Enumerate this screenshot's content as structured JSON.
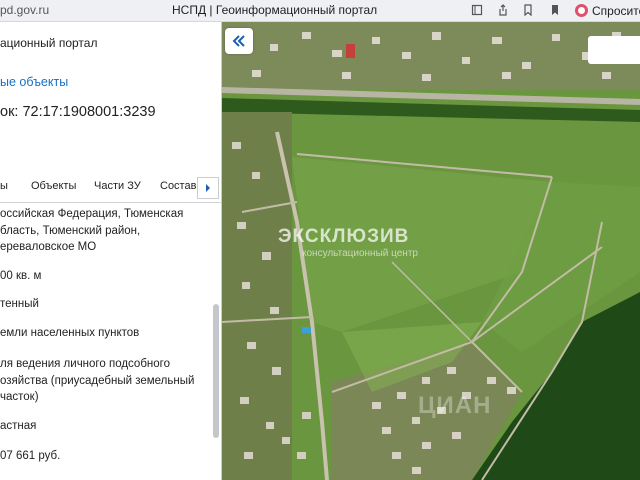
{
  "browser": {
    "url": "pd.gov.ru",
    "tab_title": "НСПД | Геоинформационный портал",
    "ask_label": "Спросите",
    "colors": {
      "ask_icon": "#e0506b"
    },
    "icons": [
      "bookmark-icon",
      "share-icon",
      "bookmark-outline-icon",
      "history-icon"
    ]
  },
  "panel": {
    "title": "ационный портал",
    "section_link": "ые объекты",
    "cadastral_line": "ок: 72:17:1908001:3239",
    "tabs": [
      "ы",
      "Объекты",
      "Части ЗУ",
      "Состав"
    ],
    "tabs_next_icon": "chevron-right-icon",
    "fields": {
      "address": [
        "оссийская Федерация, Тюменская",
        "бласть, Тюменский район,",
        "ереваловское МО"
      ],
      "area": "00 кв. м",
      "status": "тенный",
      "category": "емли населенных пунктов",
      "permitted_use": [
        "ля ведения личного подсобного",
        "озяйства (приусадебный земельный",
        "часток)"
      ],
      "ownership": "астная",
      "cadastral_value": "07 661 руб."
    },
    "colors": {
      "link": "#1a6fc4",
      "accent": "#1a5fb4"
    }
  },
  "map": {
    "collapse_icon": "double-chevron-left-icon",
    "watermark": {
      "brand": "ЭКСКЛЮЗИВ",
      "tagline": "консультационный центр",
      "secondary": "ЦИАН"
    }
  }
}
